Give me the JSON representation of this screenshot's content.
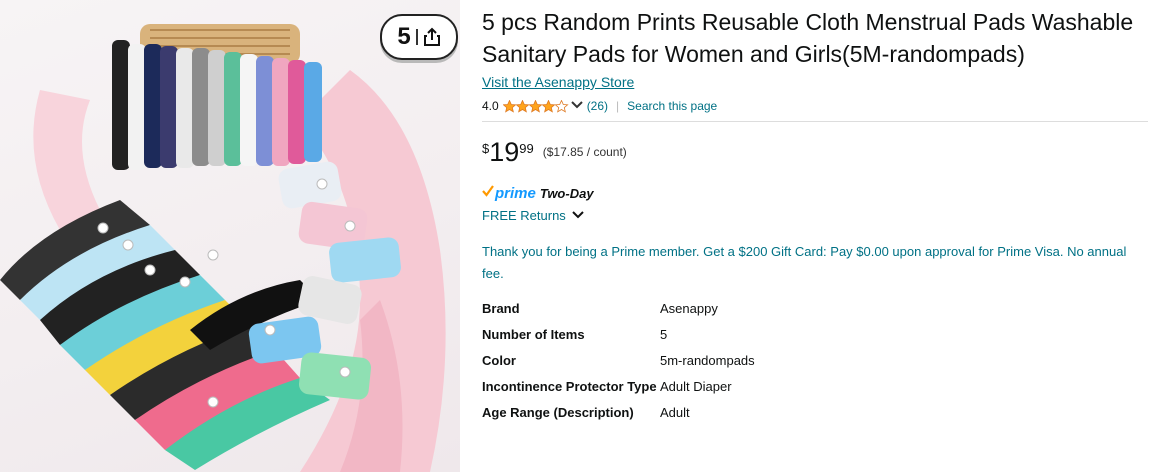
{
  "image": {
    "share_badge_count": "5",
    "share_icon": "share-icon"
  },
  "product": {
    "title": "5 pcs Random Prints Reusable Cloth Menstrual Pads Washable Sanitary Pads for Women and Girls(5M-randompads)",
    "store_link": "Visit the Asenappy Store",
    "rating_value": "4.0",
    "rating_stars": 4,
    "review_count": "(26)",
    "search_page": "Search this page",
    "separator": "|"
  },
  "price": {
    "symbol": "$",
    "whole": "19",
    "fraction": "99",
    "unit_price": "($17.85 / count)"
  },
  "delivery": {
    "prime_label": "prime",
    "two_day": "Two-Day",
    "free_returns": "FREE Returns"
  },
  "promo": {
    "text": "Thank you for being a Prime member. Get a $200 Gift Card: Pay $0.00 upon approval for Prime Visa. No annual fee."
  },
  "specs": [
    {
      "label": "Brand",
      "value": "Asenappy"
    },
    {
      "label": "Number of Items",
      "value": "5"
    },
    {
      "label": "Color",
      "value": "5m-randompads"
    },
    {
      "label": "Incontinence Protector Type",
      "value": "Adult Diaper"
    },
    {
      "label": "Age Range (Description)",
      "value": "Adult"
    }
  ],
  "colors": {
    "link": "#007185",
    "star": "#ffa41c",
    "prime_blue": "#1399ff",
    "prime_check": "#ff9900",
    "text": "#0f1111"
  }
}
